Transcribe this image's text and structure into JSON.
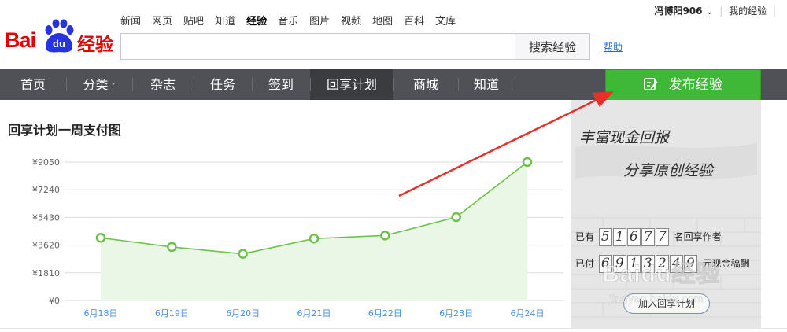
{
  "header": {
    "logo_text_left": "Bai",
    "logo_paw_text": "du",
    "logo_text_right": "经验",
    "top_nav": [
      "新闻",
      "网页",
      "贴吧",
      "知道",
      "经验",
      "音乐",
      "图片",
      "视频",
      "地图",
      "百科",
      "文库"
    ],
    "active_top_nav": "经验",
    "search": {
      "value": "",
      "button_label": "搜索经验"
    },
    "help_label": "帮助",
    "user": {
      "name": "冯博阳906",
      "my_label": "我的经验"
    }
  },
  "navbar": {
    "items": [
      {
        "label": "首页"
      },
      {
        "label": "分类"
      },
      {
        "label": "杂志"
      },
      {
        "label": "任务"
      },
      {
        "label": "签到"
      },
      {
        "label": "回享计划"
      },
      {
        "label": "商城"
      },
      {
        "label": "知道"
      }
    ],
    "active": "回享计划",
    "publish_label": "发布经验"
  },
  "main": {
    "chart_title": "回享计划一周支付图"
  },
  "chart_data": {
    "type": "area",
    "title": "回享计划一周支付图",
    "categories": [
      "6月18日",
      "6月19日",
      "6月20日",
      "6月21日",
      "6月22日",
      "6月23日",
      "6月24日"
    ],
    "series": [
      {
        "values": [
          4100,
          3500,
          3050,
          4050,
          4250,
          5450,
          9050
        ]
      }
    ],
    "y_ticks": [
      "¥0",
      "¥1810",
      "¥3620",
      "¥5430",
      "¥7240",
      "¥9050"
    ],
    "ylim": [
      0,
      9050
    ],
    "grid": true,
    "colors": {
      "line": "#6cc24a",
      "fill": "#eaf6e6",
      "marker_fill": "#ffffff",
      "arrow": "#e8302b"
    }
  },
  "promo": {
    "slogan_line1": "丰富现金回报",
    "slogan_line2": "分享原创经验",
    "sharers_prefix": "已有",
    "sharers_digits": [
      "5",
      "1",
      "6",
      "7",
      "7"
    ],
    "sharers_suffix": "名回享作者",
    "paid_prefix": "已付",
    "paid_digits": [
      "6",
      "9",
      "1",
      "3",
      "2",
      "4",
      "9"
    ],
    "paid_suffix": "元现金稿酬",
    "join_label": "加入回享计划"
  },
  "watermark": {
    "text": "Baidu经验",
    "url": "jingyan.baidu.com"
  }
}
